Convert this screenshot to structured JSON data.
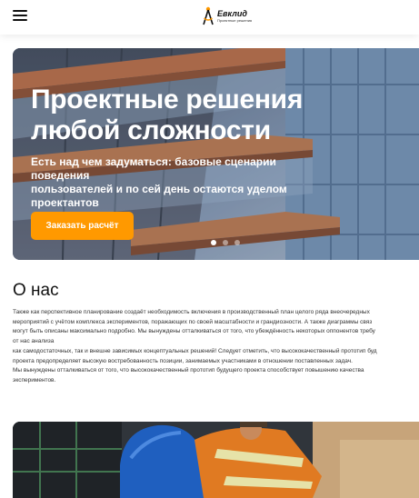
{
  "header": {
    "menu_icon": "hamburger-icon",
    "logo": {
      "icon": "compass-icon",
      "name": "Евклид",
      "subtitle": "Проектные решения"
    }
  },
  "hero": {
    "title_line1": "Проектные решения",
    "title_line2": "любой сложности",
    "subtitle_line1": "Есть над чем задуматься: базовые сценарии поведения",
    "subtitle_line2": "пользователей и по сей день остаются уделом проектантов",
    "cta_label": "Заказать расчёт",
    "slides_total": 3,
    "active_slide": 1,
    "colors": {
      "accent": "#ff9900"
    }
  },
  "about": {
    "title": "О нас",
    "lines": [
      "Также как перспективное планирование создаёт необходимость включения в производственный план целого ряда внеочередных",
      "мероприятий с учётом комплекса экспериментов, поражающих по своей масштабности и грандиозности. А также диаграммы связ",
      "могут быть описаны максимально подробно. Мы вынуждены отталкиваться от того, что убеждённость некоторых оппонентов требу",
      "от нас анализа",
      "как самодостаточных, так и внешне зависимых концептуальных решений! Следует отметить, что высококачественный прототип буд",
      "проекта предопределяет высокую востребованность позиции, занимаемых участниками в отношении поставленных задач.",
      "Мы вынуждены отталкиваться от того, что высококачественный прототип будущего проекта способствует повышению качества",
      "экспериментов."
    ]
  },
  "photo": {
    "icon": "worker-helmet-photo"
  }
}
